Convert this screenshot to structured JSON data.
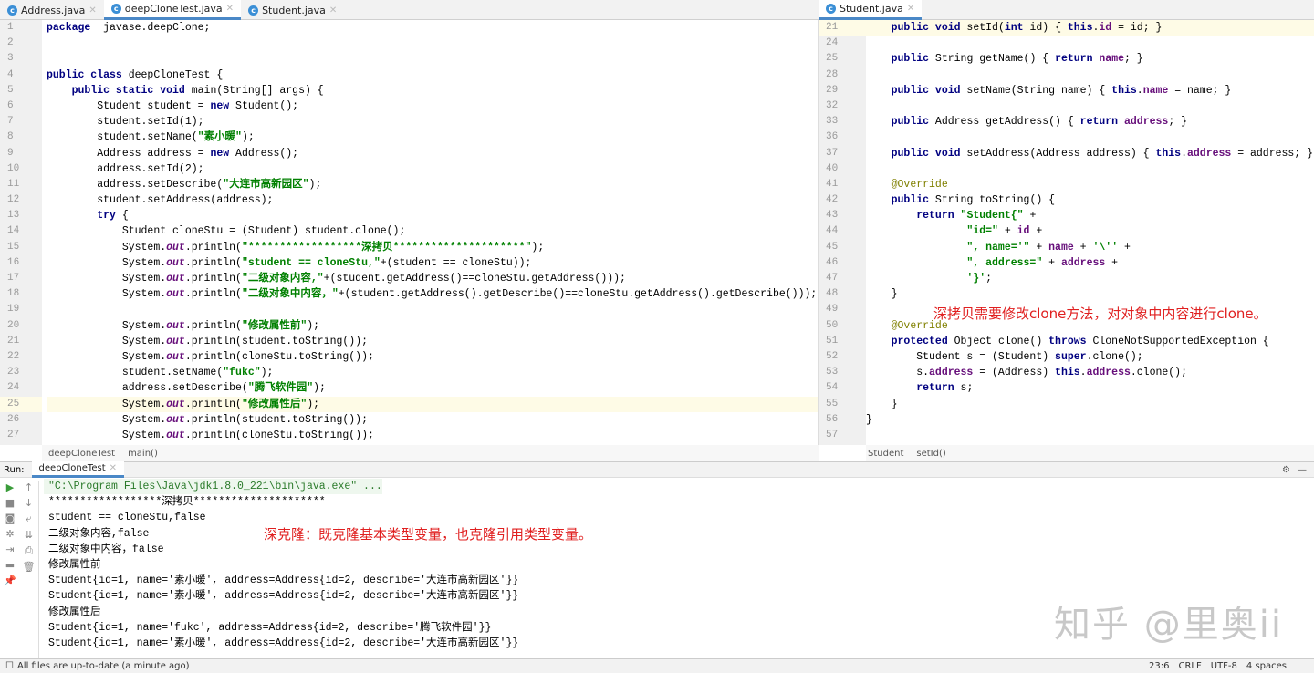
{
  "left_tabs": [
    {
      "label": "Address.java",
      "active": false
    },
    {
      "label": "deepCloneTest.java",
      "active": true
    },
    {
      "label": "Student.java",
      "active": false
    }
  ],
  "right_tabs": [
    {
      "label": "Student.java",
      "active": true
    }
  ],
  "left_editor": {
    "start": 1,
    "highlight_line": 25,
    "lines": [
      [
        [
          "kw",
          "package"
        ],
        [
          "",
          "  javase.deepClone;"
        ]
      ],
      [],
      [],
      [
        [
          "kw",
          "public class"
        ],
        [
          "",
          " deepCloneTest {"
        ]
      ],
      [
        [
          "",
          "    "
        ],
        [
          "kw",
          "public static void"
        ],
        [
          "",
          " main(String[] args) {"
        ]
      ],
      [
        [
          "",
          "        Student student = "
        ],
        [
          "kw",
          "new"
        ],
        [
          "",
          " Student();"
        ]
      ],
      [
        [
          "",
          "        student.setId(1);"
        ]
      ],
      [
        [
          "",
          "        student.setName("
        ],
        [
          "str",
          "\"素小暖\""
        ],
        [
          "",
          ");"
        ]
      ],
      [
        [
          "",
          "        Address address = "
        ],
        [
          "kw",
          "new"
        ],
        [
          "",
          " Address();"
        ]
      ],
      [
        [
          "",
          "        address.setId(2);"
        ]
      ],
      [
        [
          "",
          "        address.setDescribe("
        ],
        [
          "str",
          "\"大连市高新园区\""
        ],
        [
          "",
          ");"
        ]
      ],
      [
        [
          "",
          "        student.setAddress(address);"
        ]
      ],
      [
        [
          "",
          "        "
        ],
        [
          "kw",
          "try"
        ],
        [
          "",
          " {"
        ]
      ],
      [
        [
          "",
          "            Student cloneStu = (Student) student.clone();"
        ]
      ],
      [
        [
          "",
          "            System."
        ],
        [
          "out",
          "out"
        ],
        [
          "",
          ".println("
        ],
        [
          "str",
          "\"******************深拷贝*********************\""
        ],
        [
          "",
          ");"
        ]
      ],
      [
        [
          "",
          "            System."
        ],
        [
          "out",
          "out"
        ],
        [
          "",
          ".println("
        ],
        [
          "str",
          "\"student == cloneStu,\""
        ],
        [
          "",
          "+(student == cloneStu));"
        ]
      ],
      [
        [
          "",
          "            System."
        ],
        [
          "out",
          "out"
        ],
        [
          "",
          ".println("
        ],
        [
          "str",
          "\"二级对象内容,\""
        ],
        [
          "",
          "+(student.getAddress()==cloneStu.getAddress()));"
        ]
      ],
      [
        [
          "",
          "            System."
        ],
        [
          "out",
          "out"
        ],
        [
          "",
          ".println("
        ],
        [
          "str",
          "\"二级对象中内容，\""
        ],
        [
          "",
          "+(student.getAddress().getDescribe()==cloneStu.getAddress().getDescribe()));"
        ]
      ],
      [],
      [
        [
          "",
          "            System."
        ],
        [
          "out",
          "out"
        ],
        [
          "",
          ".println("
        ],
        [
          "str",
          "\"修改属性前\""
        ],
        [
          "",
          ");"
        ]
      ],
      [
        [
          "",
          "            System."
        ],
        [
          "out",
          "out"
        ],
        [
          "",
          ".println(student.toString());"
        ]
      ],
      [
        [
          "",
          "            System."
        ],
        [
          "out",
          "out"
        ],
        [
          "",
          ".println(cloneStu.toString());"
        ]
      ],
      [
        [
          "",
          "            student.setName("
        ],
        [
          "str",
          "\"fukc\""
        ],
        [
          "",
          ");"
        ]
      ],
      [
        [
          "",
          "            address.setDescribe("
        ],
        [
          "str",
          "\"腾飞软件园\""
        ],
        [
          "",
          ");"
        ]
      ],
      [
        [
          "",
          "            System."
        ],
        [
          "out",
          "out"
        ],
        [
          "",
          ".println("
        ],
        [
          "str",
          "\"修改属性后\""
        ],
        [
          "",
          ");"
        ]
      ],
      [
        [
          "",
          "            System."
        ],
        [
          "out",
          "out"
        ],
        [
          "",
          ".println(student.toString());"
        ]
      ],
      [
        [
          "",
          "            System."
        ],
        [
          "out",
          "out"
        ],
        [
          "",
          ".println(cloneStu.toString());"
        ]
      ]
    ]
  },
  "right_editor": {
    "numbers": [
      21,
      24,
      25,
      28,
      29,
      32,
      33,
      36,
      37,
      40,
      41,
      42,
      43,
      44,
      45,
      46,
      47,
      48,
      49,
      50,
      51,
      52,
      53,
      54,
      55,
      56,
      57
    ],
    "highlight_index": 0,
    "lines": [
      [
        [
          "",
          "    "
        ],
        [
          "kw",
          "public void"
        ],
        [
          "",
          " setId("
        ],
        [
          "kw",
          "int"
        ],
        [
          "",
          " id) { "
        ],
        [
          "kw",
          "this"
        ],
        [
          "",
          "."
        ],
        [
          "fld",
          "id"
        ],
        [
          "",
          " = id; }"
        ]
      ],
      [],
      [
        [
          "",
          "    "
        ],
        [
          "kw",
          "public"
        ],
        [
          "",
          " String getName() { "
        ],
        [
          "kw",
          "return"
        ],
        [
          "",
          " "
        ],
        [
          "fld",
          "name"
        ],
        [
          "",
          "; }"
        ]
      ],
      [],
      [
        [
          "",
          "    "
        ],
        [
          "kw",
          "public void"
        ],
        [
          "",
          " setName(String name) { "
        ],
        [
          "kw",
          "this"
        ],
        [
          "",
          "."
        ],
        [
          "fld",
          "name"
        ],
        [
          "",
          " = name; }"
        ]
      ],
      [],
      [
        [
          "",
          "    "
        ],
        [
          "kw",
          "public"
        ],
        [
          "",
          " Address getAddress() { "
        ],
        [
          "kw",
          "return"
        ],
        [
          "",
          " "
        ],
        [
          "fld",
          "address"
        ],
        [
          "",
          "; }"
        ]
      ],
      [],
      [
        [
          "",
          "    "
        ],
        [
          "kw",
          "public void"
        ],
        [
          "",
          " setAddress(Address address) { "
        ],
        [
          "kw",
          "this"
        ],
        [
          "",
          "."
        ],
        [
          "fld",
          "address"
        ],
        [
          "",
          " = address; }"
        ]
      ],
      [],
      [
        [
          "",
          "    "
        ],
        [
          "ann",
          "@Override"
        ]
      ],
      [
        [
          "",
          "    "
        ],
        [
          "kw",
          "public"
        ],
        [
          "",
          " String toString() {"
        ]
      ],
      [
        [
          "",
          "        "
        ],
        [
          "kw",
          "return"
        ],
        [
          "",
          " "
        ],
        [
          "str",
          "\"Student{\""
        ],
        [
          "",
          " +"
        ]
      ],
      [
        [
          "",
          "                "
        ],
        [
          "str",
          "\"id=\""
        ],
        [
          "",
          " + "
        ],
        [
          "fld",
          "id"
        ],
        [
          "",
          " +"
        ]
      ],
      [
        [
          "",
          "                "
        ],
        [
          "str",
          "\", name='\""
        ],
        [
          "",
          " + "
        ],
        [
          "fld",
          "name"
        ],
        [
          "",
          " + "
        ],
        [
          "str",
          "'\\''"
        ],
        [
          "",
          " +"
        ]
      ],
      [
        [
          "",
          "                "
        ],
        [
          "str",
          "\", address=\""
        ],
        [
          "",
          " + "
        ],
        [
          "fld",
          "address"
        ],
        [
          "",
          " +"
        ]
      ],
      [
        [
          "",
          "                "
        ],
        [
          "str",
          "'}'"
        ],
        [
          "",
          ";"
        ]
      ],
      [
        [
          "",
          "    }"
        ]
      ],
      [],
      [
        [
          "",
          "    "
        ],
        [
          "ann",
          "@Override"
        ]
      ],
      [
        [
          "",
          "    "
        ],
        [
          "kw",
          "protected"
        ],
        [
          "",
          " Object clone() "
        ],
        [
          "kw",
          "throws"
        ],
        [
          "",
          " CloneNotSupportedException {"
        ]
      ],
      [
        [
          "",
          "        Student s = (Student) "
        ],
        [
          "kw",
          "super"
        ],
        [
          "",
          ".clone();"
        ]
      ],
      [
        [
          "",
          "        s."
        ],
        [
          "fld",
          "address"
        ],
        [
          "",
          " = (Address) "
        ],
        [
          "kw",
          "this"
        ],
        [
          "",
          "."
        ],
        [
          "fld",
          "address"
        ],
        [
          "",
          ".clone();"
        ]
      ],
      [
        [
          "",
          "        "
        ],
        [
          "kw",
          "return"
        ],
        [
          "",
          " s;"
        ]
      ],
      [
        [
          "",
          "    }"
        ]
      ],
      [
        [
          "",
          "}"
        ]
      ],
      []
    ]
  },
  "left_breadcrumb": [
    "deepCloneTest",
    "main()"
  ],
  "right_breadcrumb": [
    "Student",
    "setId()"
  ],
  "annotation_right": "深拷贝需要修改clone方法，对对象中内容进行clone。",
  "annotation_console": "深克隆：既克隆基本类型变量，也克隆引用类型变量。",
  "run": {
    "label": "Run:",
    "tab": "deepCloneTest",
    "output": [
      "\"C:\\Program Files\\Java\\jdk1.8.0_221\\bin\\java.exe\" ...",
      "******************深拷贝*********************",
      "student == cloneStu,false",
      "二级对象内容,false",
      "二级对象中内容，false",
      "修改属性前",
      "Student{id=1, name='素小暖', address=Address{id=2, describe='大连市高新园区'}}",
      "Student{id=1, name='素小暖', address=Address{id=2, describe='大连市高新园区'}}",
      "修改属性后",
      "Student{id=1, name='fukc', address=Address{id=2, describe='腾飞软件园'}}",
      "Student{id=1, name='素小暖', address=Address{id=2, describe='大连市高新园区'}}"
    ]
  },
  "status": {
    "message": "All files are up-to-date (a minute ago)",
    "position": "23:6",
    "line_sep": "CRLF",
    "encoding": "UTF-8",
    "indent": "4 spaces"
  },
  "watermark": "知乎 @里奥ii"
}
